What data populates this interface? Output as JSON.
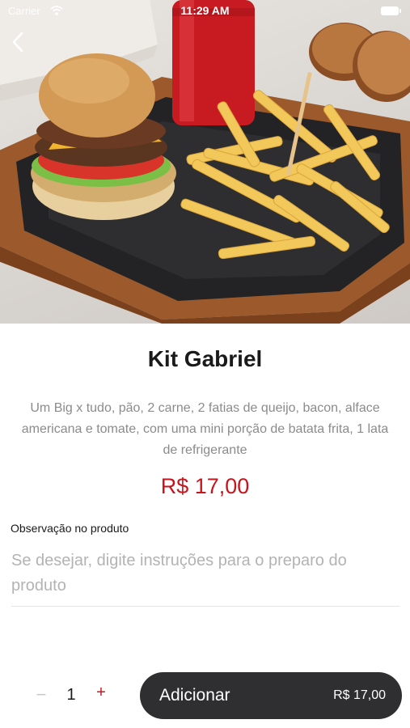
{
  "status_bar": {
    "carrier": "Carrier",
    "time": "11:29 AM"
  },
  "product": {
    "name": "Kit Gabriel",
    "description": "Um Big x tudo, pão, 2 carne, 2 fatias de queijo, bacon, alface americana e tomate, com uma mini porção de batata frita, 1 lata de refrigerante",
    "price": "R$ 17,00",
    "image_alt": "Hambúrguer com batata frita e refrigerante"
  },
  "observation": {
    "label": "Observação no produto",
    "placeholder": "Se desejar, digite instruções para o preparo do produto",
    "value": ""
  },
  "quantity": {
    "value": "1",
    "minus_symbol": "−",
    "plus_symbol": "+"
  },
  "add_button": {
    "label": "Adicionar",
    "price": "R$ 17,00"
  },
  "colors": {
    "accent_red": "#c8151b",
    "button_dark": "#2f2f31",
    "muted_text": "#8b8b8b"
  },
  "icons": {
    "back": "chevron-left-icon",
    "wifi": "wifi-icon",
    "battery": "battery-icon"
  }
}
